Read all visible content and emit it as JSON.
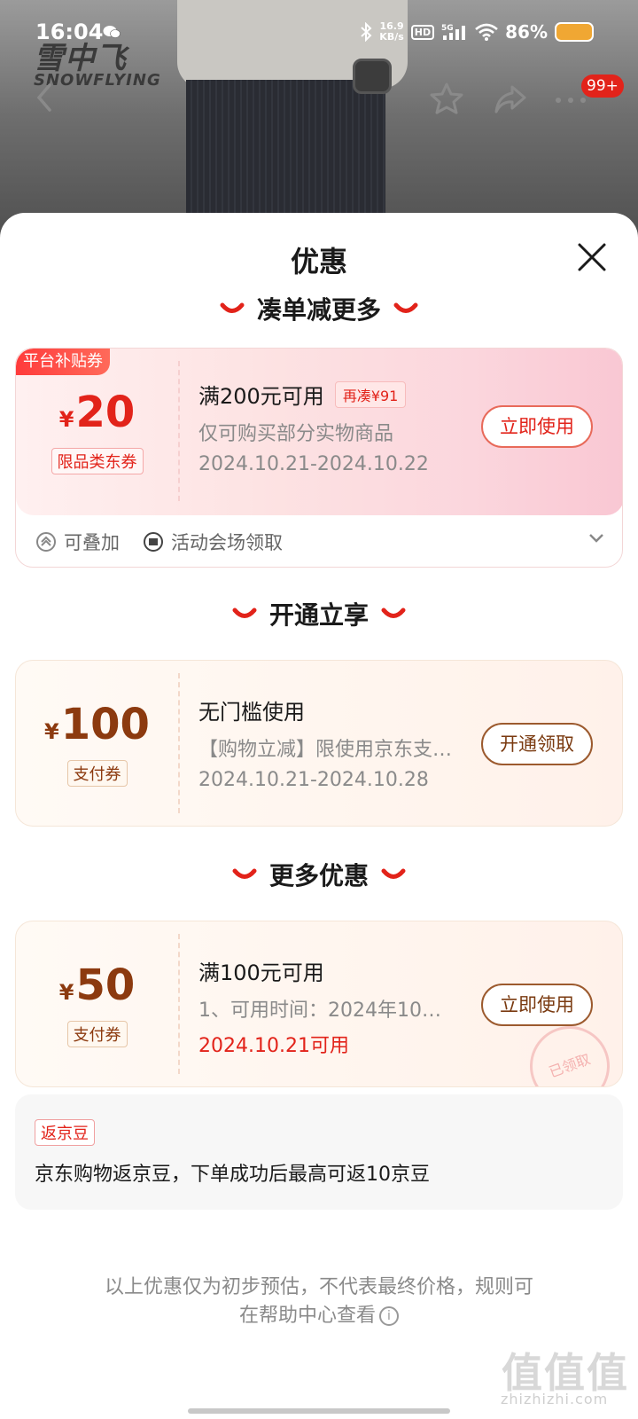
{
  "status_bar": {
    "time": "16:04",
    "net_speed_value": "16.9",
    "net_speed_unit": "KB/s",
    "hd": "HD",
    "signal": "5G",
    "battery": "86%"
  },
  "product": {
    "brand_logo": "雪中飞",
    "brand_sub": "SNOWFLYING"
  },
  "nav": {
    "badge": "99+"
  },
  "sheet": {
    "title": "优惠",
    "sections": {
      "combine": "凑单减更多",
      "activate": "开通立享",
      "more": "更多优惠"
    }
  },
  "coupons": [
    {
      "corner_tag": "平台补贴券",
      "currency": "¥",
      "amount": "20",
      "type_tag": "限品类东券",
      "title": "满200元可用",
      "extra": "再凑¥91",
      "desc": "仅可购买部分实物商品",
      "date": "2024.10.21-2024.10.22",
      "button": "立即使用",
      "footer": {
        "stackable": "可叠加",
        "source": "活动会场领取"
      }
    },
    {
      "currency": "¥",
      "amount": "100",
      "type_tag": "支付券",
      "title": "无门槛使用",
      "desc": "【购物立减】限使用京东支付…",
      "date": "2024.10.21-2024.10.28",
      "button": "开通领取"
    },
    {
      "currency": "¥",
      "amount": "50",
      "type_tag": "支付券",
      "title": "满100元可用",
      "desc": "1、可用时间：2024年10…",
      "date": "2024.10.21可用",
      "button": "立即使用",
      "stamp": "已领取"
    }
  ],
  "beans": {
    "tag": "返京豆",
    "text": "京东购物返京豆，下单成功后最高可返10京豆"
  },
  "disclaimer": {
    "line1": "以上优惠仅为初步预估，不代表最终价格，规则可",
    "line2": "在帮助中心查看"
  },
  "watermark": {
    "main": "值值值",
    "sub": "zhizhizhi.com"
  },
  "colors": {
    "accent_red": "#e2231a",
    "brown": "#8c3a0f"
  }
}
